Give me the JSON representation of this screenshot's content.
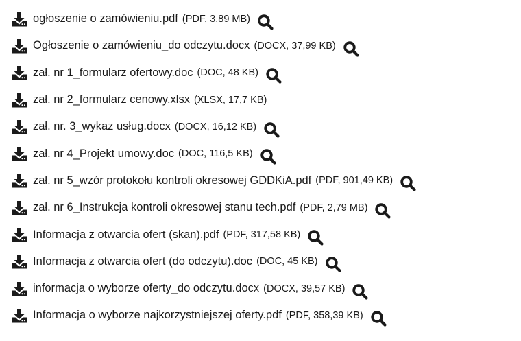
{
  "files": [
    {
      "name": "ogłoszenie o zamówieniu.pdf",
      "meta": "(PDF, 3,89 MB)",
      "preview": true
    },
    {
      "name": "Ogłoszenie o zamówieniu_do odczytu.docx",
      "meta": "(DOCX, 37,99 KB)",
      "preview": true
    },
    {
      "name": "zał. nr 1_formularz ofertowy.doc",
      "meta": "(DOC, 48 KB)",
      "preview": true
    },
    {
      "name": "zał. nr 2_formularz cenowy.xlsx",
      "meta": "(XLSX, 17,7 KB)",
      "preview": false
    },
    {
      "name": "zał. nr. 3_wykaz usług.docx",
      "meta": "(DOCX, 16,12 KB)",
      "preview": true
    },
    {
      "name": "zał. nr 4_Projekt umowy.doc",
      "meta": "(DOC, 116,5 KB)",
      "preview": true
    },
    {
      "name": "zał. nr 5_wzór protokołu kontroli okresowej GDDKiA.pdf",
      "meta": "(PDF, 901,49 KB)",
      "preview": true
    },
    {
      "name": "zał. nr 6_Instrukcja kontroli okresowej stanu tech.pdf",
      "meta": "(PDF, 2,79 MB)",
      "preview": true
    },
    {
      "name": "Informacja z otwarcia ofert (skan).pdf",
      "meta": "(PDF, 317,58 KB)",
      "preview": true
    },
    {
      "name": "Informacja z otwarcia ofert (do odczytu).doc",
      "meta": "(DOC, 45 KB)",
      "preview": true
    },
    {
      "name": "informacja o wyborze oferty_do odczytu.docx",
      "meta": "(DOCX, 39,57 KB)",
      "preview": true
    },
    {
      "name": "Informacja o wyborze najkorzystniejszej oferty.pdf",
      "meta": "(PDF, 358,39 KB)",
      "preview": true
    }
  ],
  "icons": {
    "download": "download-icon",
    "preview": "search-icon"
  },
  "colors": {
    "icon": "#1a1a1a",
    "text": "#1a1a1a",
    "background": "#ffffff"
  }
}
